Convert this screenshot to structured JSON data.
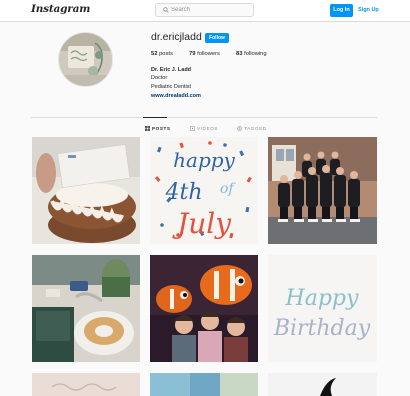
{
  "nav": {
    "logo": "Instagram",
    "search_placeholder": "Search",
    "login_label": "Log In",
    "signup_label": "Sign Up"
  },
  "profile": {
    "username": "dr.ericjladd",
    "follow_label": "Follow",
    "posts_count": "52",
    "posts_label": "posts",
    "followers_count": "79",
    "followers_label": "followers",
    "following_count": "83",
    "following_label": "following",
    "display_name": "Dr. Eric J. Ladd",
    "bio_lines": [
      "Doctor",
      "Pediatric Dentist"
    ],
    "website": "www.drealadd.com"
  },
  "tabs": [
    {
      "label": "POSTS",
      "icon": "grid-icon",
      "active": true
    },
    {
      "label": "VIDEOS",
      "icon": "video-icon",
      "active": false
    },
    {
      "label": "TAGGED",
      "icon": "tag-icon",
      "active": false
    }
  ],
  "posts": [
    {
      "name": "post-bundt-cake",
      "caption_lines": [
        "Nothing Bundt Cakes",
        "Barry Bonds",
        "Thank you for all",
        "you do for our",
        "patients"
      ]
    },
    {
      "name": "post-happy-4th-of-july",
      "text_lines": [
        "happy",
        "4th",
        "of",
        "July"
      ]
    },
    {
      "name": "post-staff-group-photo"
    },
    {
      "name": "post-coffee-table"
    },
    {
      "name": "post-finding-nemo-kids"
    },
    {
      "name": "post-happy-birthday",
      "text_lines": [
        "Happy",
        "Birthday"
      ]
    },
    {
      "name": "post-partial-1"
    },
    {
      "name": "post-partial-2"
    },
    {
      "name": "post-partial-3"
    }
  ],
  "colors": {
    "accent": "#0095f6",
    "link": "#00376b",
    "border": "#dbdbdb",
    "background": "#fafafa"
  }
}
